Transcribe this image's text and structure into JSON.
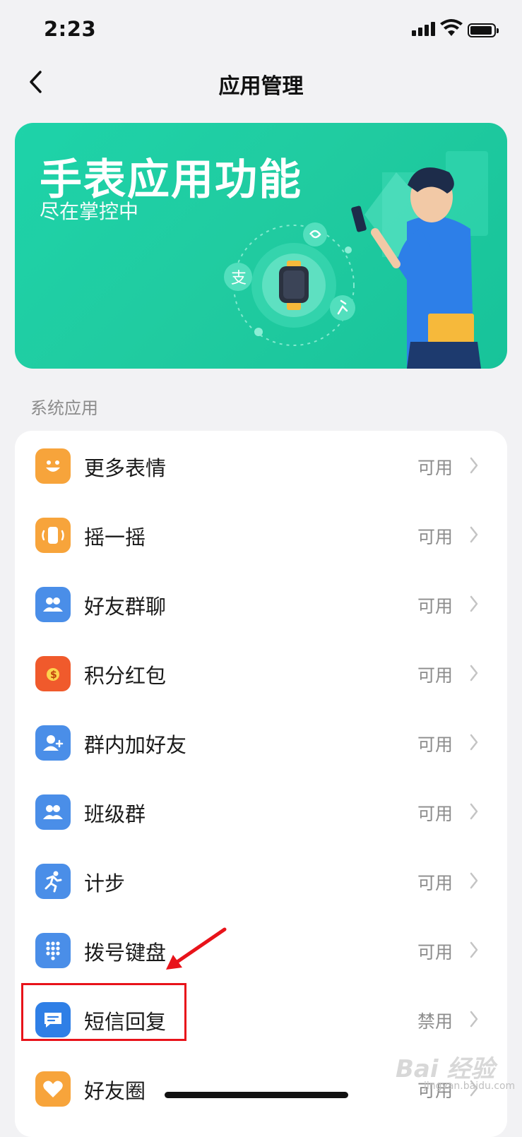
{
  "status_bar": {
    "time": "2:23"
  },
  "nav": {
    "title": "应用管理"
  },
  "banner": {
    "title": "手表应用功能",
    "subtitle": "尽在掌控中"
  },
  "section": {
    "title": "系统应用"
  },
  "apps": [
    {
      "name": "更多表情",
      "status": "可用",
      "icon": "smiley-icon",
      "color": "#f7a43b"
    },
    {
      "name": "摇一摇",
      "status": "可用",
      "icon": "shake-watch-icon",
      "color": "#f7a43b"
    },
    {
      "name": "好友群聊",
      "status": "可用",
      "icon": "group-chat-icon",
      "color": "#4a8ee8"
    },
    {
      "name": "积分红包",
      "status": "可用",
      "icon": "red-packet-icon",
      "color": "#f05a2c"
    },
    {
      "name": "群内加好友",
      "status": "可用",
      "icon": "add-friend-icon",
      "color": "#4a8ee8"
    },
    {
      "name": "班级群",
      "status": "可用",
      "icon": "class-group-icon",
      "color": "#4a8ee8"
    },
    {
      "name": "计步",
      "status": "可用",
      "icon": "running-icon",
      "color": "#4a8ee8"
    },
    {
      "name": "拨号键盘",
      "status": "可用",
      "icon": "dialpad-icon",
      "color": "#4a8ee8"
    },
    {
      "name": "短信回复",
      "status": "禁用",
      "icon": "sms-reply-icon",
      "color": "#2f7fe6"
    },
    {
      "name": "好友圈",
      "status": "可用",
      "icon": "heart-icon",
      "color": "#f7a43b"
    }
  ],
  "watermark": {
    "text": "Bai 经验",
    "sub": "jingyan.baidu.com"
  },
  "colors": {
    "accent_green": "#1ed3a9",
    "highlight_red": "#e8131a",
    "background": "#f2f2f4"
  }
}
